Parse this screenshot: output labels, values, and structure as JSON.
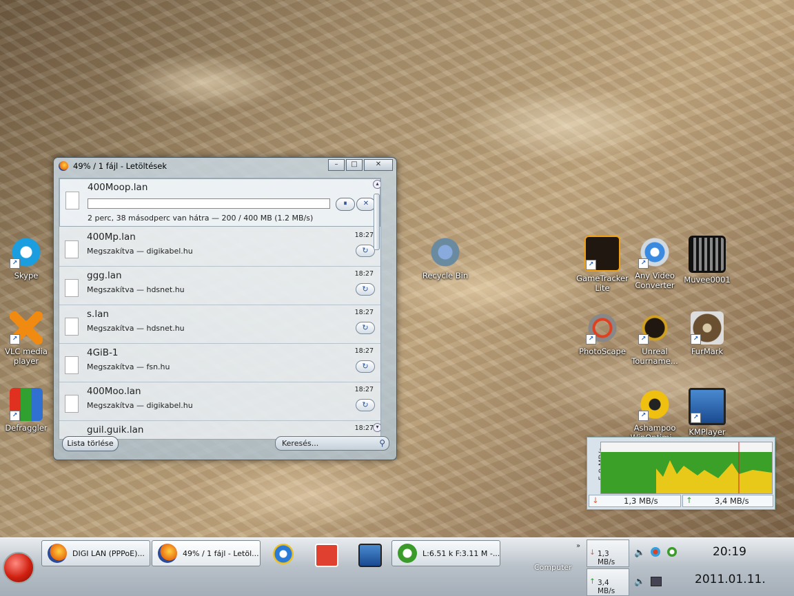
{
  "desktop_icons": [
    {
      "label": "Skype",
      "color": "#1a9ee0"
    },
    {
      "label": "VLC media player",
      "color": "#f08a10"
    },
    {
      "label": "Defraggler",
      "color": "#3070d0"
    },
    {
      "label": "Recycle Bin",
      "color": "#6a8aa0"
    },
    {
      "label": "GameTracker Lite",
      "color": "#f0a010"
    },
    {
      "label": "Any Video Converter",
      "color": "#3a8ae0"
    },
    {
      "label": "Muvee0001",
      "color": "#606060"
    },
    {
      "label": "PhotoScape",
      "color": "#e04020"
    },
    {
      "label": "Unreal Tourname...",
      "color": "#201810"
    },
    {
      "label": "FurMark",
      "color": "#6a5030"
    },
    {
      "label": "Ashampoo WinOptimi...",
      "color": "#f0c010"
    },
    {
      "label": "KMPlayer",
      "color": "#1a5ab0"
    }
  ],
  "download_window": {
    "title": "49% / 1 fájl - Letöltések",
    "active": {
      "name": "400Moop.lan",
      "status": "2 perc, 38 másodperc van hátra — 200 / 400 MB (1.2 MB/s)",
      "progress": 0.0
    },
    "items": [
      {
        "name": "400Mp.lan",
        "status": "Megszakítva — digikabel.hu",
        "time": "18:27"
      },
      {
        "name": "ggg.lan",
        "status": "Megszakítva — hdsnet.hu",
        "time": "18:27"
      },
      {
        "name": "s.lan",
        "status": "Megszakítva — hdsnet.hu",
        "time": "18:27"
      },
      {
        "name": "4GiB-1",
        "status": "Megszakítva — fsn.hu",
        "time": "18:27"
      },
      {
        "name": "400Moo.lan",
        "status": "Megszakítva — digikabel.hu",
        "time": "18:27"
      },
      {
        "name": "guil.guik.lan",
        "status": "",
        "time": "18:27"
      }
    ],
    "clear_label": "Lista törlése",
    "search_placeholder": "Keresés..."
  },
  "net_graph": {
    "ylabel": "5,9 MB/s",
    "down": "1,3 MB/s",
    "up": "3,4 MB/s"
  },
  "taskbar": {
    "buttons": [
      {
        "label": "DIGI LAN (PPPoE)...",
        "color": "#e86a10"
      },
      {
        "label": "49% / 1 fájl - Letöl...",
        "color": "#e86a10"
      },
      {
        "label": "L:6.51 k F:3.11 M -...",
        "color": "#3a9a2a"
      }
    ],
    "toolbar_label": "Computer",
    "tray_down": "1,3 MB/s",
    "tray_up": "3,4 MB/s",
    "time": "20:19",
    "date": "2011.01.11."
  }
}
